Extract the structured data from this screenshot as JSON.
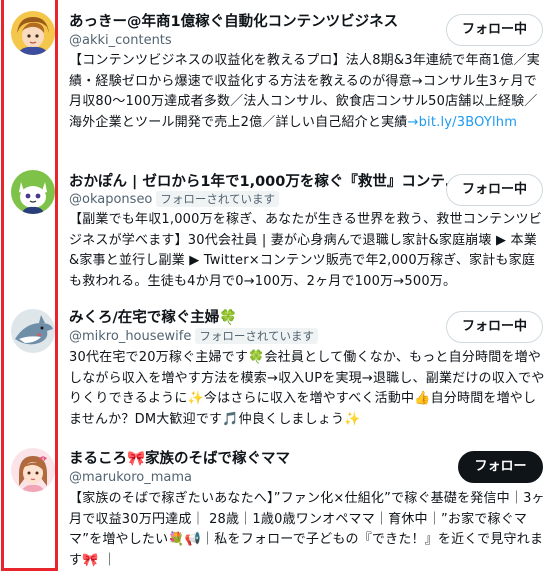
{
  "accounts": [
    {
      "name": "あっきー@年商1億稼ぐ自動化コンテンツビジネス",
      "handle": "@akki_contents",
      "follows_you": "",
      "button": "フォロー中",
      "bio": "【コンテンツビジネスの収益化を教えるプロ】法人8期&3年連続で年商1億／実績・経験ゼロから爆速で収益化する方法を教えるのが得意→コンサル生3ヶ月で月収80～100万達成者多数／法人コンサル、飲食店コンサル50店舗以上経験／海外企業とツール開発で売上2億／詳しい自己紹介と実績",
      "bio_link": "→bit.ly/3BOYlhm"
    },
    {
      "name": "おかぽん | ゼロから1年で1,000万を稼ぐ『救世』コンテ…",
      "handle": "@okaponseo",
      "follows_you": "フォローされています",
      "button": "フォロー中",
      "bio": "【副業でも年収1,000万を稼ぎ、あなたが生きる世界を救う、救世コンテンツビジネスが学べます】30代会社員 | 妻が心身病んで退職し家計&家庭崩壊 ▶ 本業&家事と並行し副業 ▶ Twitter×コンテンツ販売で年2,000万稼ぎ、家計も家庭も救われる。生徒も4か月で0→100万、2ヶ月で100万→500万。",
      "bio_link": ""
    },
    {
      "name": "みくろ/在宅で稼ぐ主婦🍀",
      "handle": "@mikro_housewife",
      "follows_you": "フォローされています",
      "button": "フォロー中",
      "bio": "30代在宅で20万稼ぐ主婦です🍀会社員として働くなか、もっと自分時間を増やしながら収入を増やす方法を模索→収入UPを実現→退職し、副業だけの収入でやりくりできるように✨今はさらに収入を増やすべく活動中👍自分時間を増やしませんか？DM大歓迎です🎵仲良くしましょう✨",
      "bio_link": ""
    },
    {
      "name": "まるころ🎀家族のそばで稼ぐママ",
      "handle": "@marukoro_mama",
      "follows_you": "",
      "button": "フォロー",
      "bio": "【家族のそばで稼ぎたいあなたへ】”ファン化×仕組化”で稼ぐ基礎を発信中｜3ヶ月で収益30万円達成｜ 28歳｜1歳0歳ワンオペママ｜育休中｜”お家で稼ぐママ”を増やしたい💐📢｜私をフォローで子どもの『できた！』を近くで見守れます🎀 ｜",
      "bio_link": ""
    }
  ],
  "colors": {
    "frame": "#e8242c",
    "link": "#1d9bf0",
    "secondary_text": "#536471",
    "follow_button_bg": "#0f1419"
  }
}
